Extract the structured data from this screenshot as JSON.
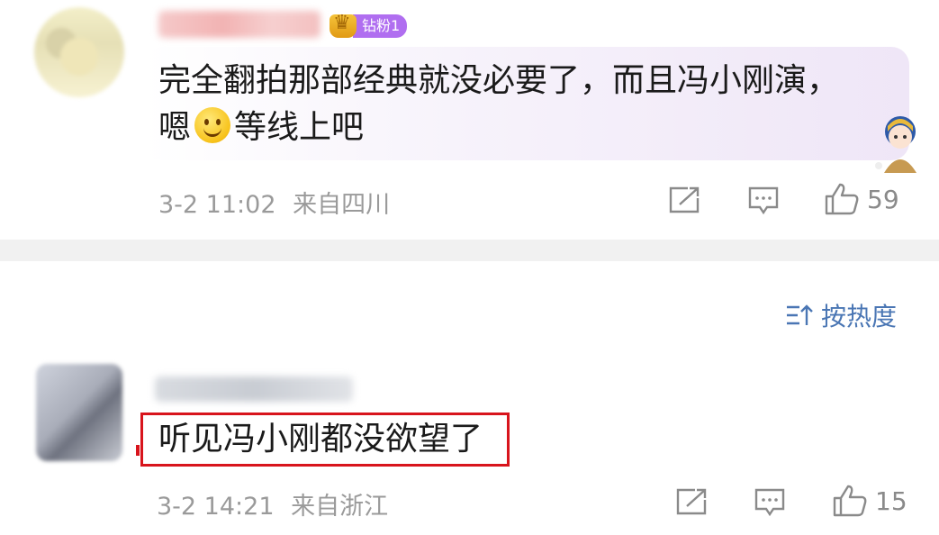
{
  "comments": [
    {
      "badge": "钻粉1",
      "text_line1": "完全翻拍那部经典就没必要了，而且冯小刚演，",
      "text_line2a": "嗯",
      "text_line2b": "等线上吧",
      "time": "3-2 11:02",
      "location": "来自四川",
      "likes": "59",
      "emoji": "smile-emoji"
    },
    {
      "text": "听见冯小刚都没欲望了",
      "time": "3-2 14:21",
      "location": "来自浙江",
      "likes": "15"
    }
  ],
  "sort": {
    "label": "按热度",
    "icon": "sort-icon"
  },
  "colors": {
    "link": "#4a76b4",
    "highlight_border": "#d8141c",
    "badge": "#b06ef0"
  }
}
